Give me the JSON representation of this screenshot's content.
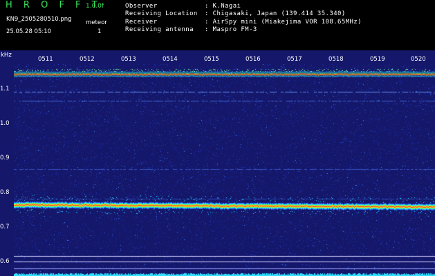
{
  "header": {
    "app_title": "H R O F F T",
    "version": "1.0.0f",
    "filename": "KN9_2505280510.png",
    "timestamp": "25.05.28 05:10",
    "meteor_label": "meteor",
    "meteor_count": "1",
    "info": [
      {
        "label": "Observer",
        "value": ": K.Nagai"
      },
      {
        "label": "Receiving Location",
        "value": ": Chigasaki, Japan (139.414 35.340)"
      },
      {
        "label": "Receiver",
        "value": ": AirSpy mini (Miakejima VOR 108.65MHz)"
      },
      {
        "label": "Receiving antenna",
        "value": ": Maspro FM-3"
      }
    ]
  },
  "spectrogram": {
    "y_unit": "kHz",
    "y_ticks": [
      "1.1",
      "1.0",
      "0.9",
      "0.8",
      "0.7",
      "0.6"
    ],
    "time_ticks": [
      "0511",
      "0512",
      "0513",
      "0514",
      "0515",
      "0516",
      "0517",
      "0518",
      "0519",
      "0520"
    ],
    "colors": {
      "background": "#14176a",
      "accent": "#39e05a",
      "signal": "#ff2020"
    }
  }
}
